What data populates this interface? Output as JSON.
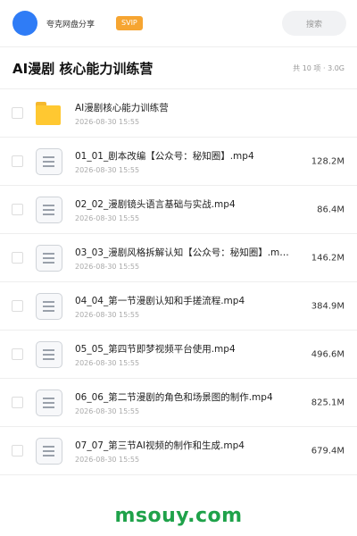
{
  "topbar": {
    "title": "夸克网盘分享",
    "badge": "SVIP",
    "search_placeholder": "搜索"
  },
  "header": {
    "title": "AI漫剧 核心能力训练营",
    "meta": "共 10 项 · 3.0G"
  },
  "items": [
    {
      "name": "AI漫剧核心能力训练营",
      "date": "2026-08-30 15:55",
      "size": "",
      "type": "folder-icon"
    },
    {
      "name": "01_01_剧本改编【公众号：秘知圈】.mp4",
      "date": "2026-08-30 15:55",
      "size": "128.2M",
      "type": "video-file-icon"
    },
    {
      "name": "02_02_漫剧镜头语言基础与实战.mp4",
      "date": "2026-08-30 15:55",
      "size": "86.4M",
      "type": "video-file-icon"
    },
    {
      "name": "03_03_漫剧风格拆解认知【公众号：秘知圈】.m…",
      "date": "2026-08-30 15:55",
      "size": "146.2M",
      "type": "video-file-icon"
    },
    {
      "name": "04_04_第一节漫剧认知和手搓流程.mp4",
      "date": "2026-08-30 15:55",
      "size": "384.9M",
      "type": "video-file-icon"
    },
    {
      "name": "05_05_第四节即梦视频平台使用.mp4",
      "date": "2026-08-30 15:55",
      "size": "496.6M",
      "type": "video-file-icon"
    },
    {
      "name": "06_06_第二节漫剧的角色和场景图的制作.mp4",
      "date": "2026-08-30 15:55",
      "size": "825.1M",
      "type": "video-file-icon"
    },
    {
      "name": "07_07_第三节AI视频的制作和生成.mp4",
      "date": "2026-08-30 15:55",
      "size": "679.4M",
      "type": "video-file-icon"
    }
  ],
  "watermark": "msouy.com",
  "colors": {
    "brand_blue": "#2f7cf6",
    "svip_orange": "#f6a531",
    "folder_yellow": "#ffc831",
    "watermark_green": "#1fa24a"
  }
}
